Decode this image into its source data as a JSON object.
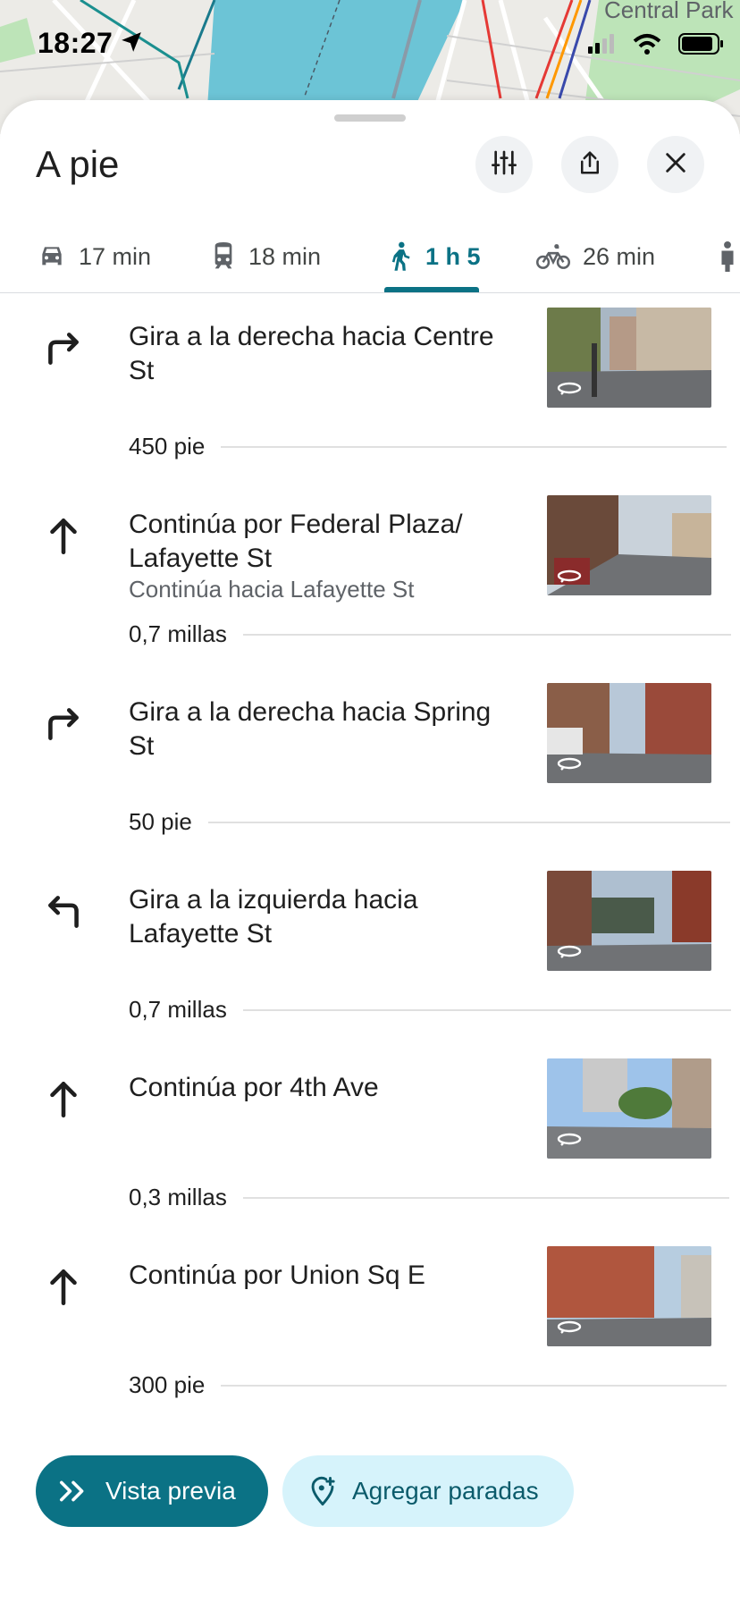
{
  "status_bar": {
    "time": "18:27"
  },
  "map": {
    "label": "Central Park"
  },
  "header": {
    "title": "A pie",
    "icons": [
      "options-icon",
      "share-icon",
      "close-icon"
    ]
  },
  "tabs": [
    {
      "mode": "car",
      "label": "17 min",
      "icon": "car-icon"
    },
    {
      "mode": "transit",
      "label": "18 min",
      "icon": "train-icon"
    },
    {
      "mode": "walk",
      "label": "1 h 5",
      "icon": "walking-icon",
      "selected": true
    },
    {
      "mode": "bike",
      "label": "26 min",
      "icon": "bicycle-icon"
    },
    {
      "mode": "ride",
      "label": "",
      "icon": "person-icon"
    }
  ],
  "steps": [
    {
      "direction": "turn-right",
      "instruction": "Gira a la derecha hacia Centre St",
      "detail": "",
      "distance_after": "450 pie"
    },
    {
      "direction": "straight",
      "instruction": "Continúa por Federal Plaza/ Lafayette St",
      "detail": "Continúa hacia Lafayette St",
      "distance_after": "0,7 millas"
    },
    {
      "direction": "turn-right",
      "instruction": "Gira a la derecha hacia Spring St",
      "detail": "",
      "distance_after": "50 pie"
    },
    {
      "direction": "turn-left",
      "instruction": "Gira a la izquierda hacia Lafayette St",
      "detail": "",
      "distance_after": "0,7 millas"
    },
    {
      "direction": "straight",
      "instruction": "Continúa por 4th Ave",
      "detail": "",
      "distance_after": "0,3 millas"
    },
    {
      "direction": "straight",
      "instruction": "Continúa por Union Sq E",
      "detail": "",
      "distance_after": "300 pie"
    }
  ],
  "actions": {
    "preview": "Vista previa",
    "add_stops": "Agregar paradas"
  },
  "colors": {
    "accent": "#0b7285",
    "secondary_bg": "#d6f3fb",
    "water": "#6cc4d6",
    "park": "#bde4b8"
  }
}
